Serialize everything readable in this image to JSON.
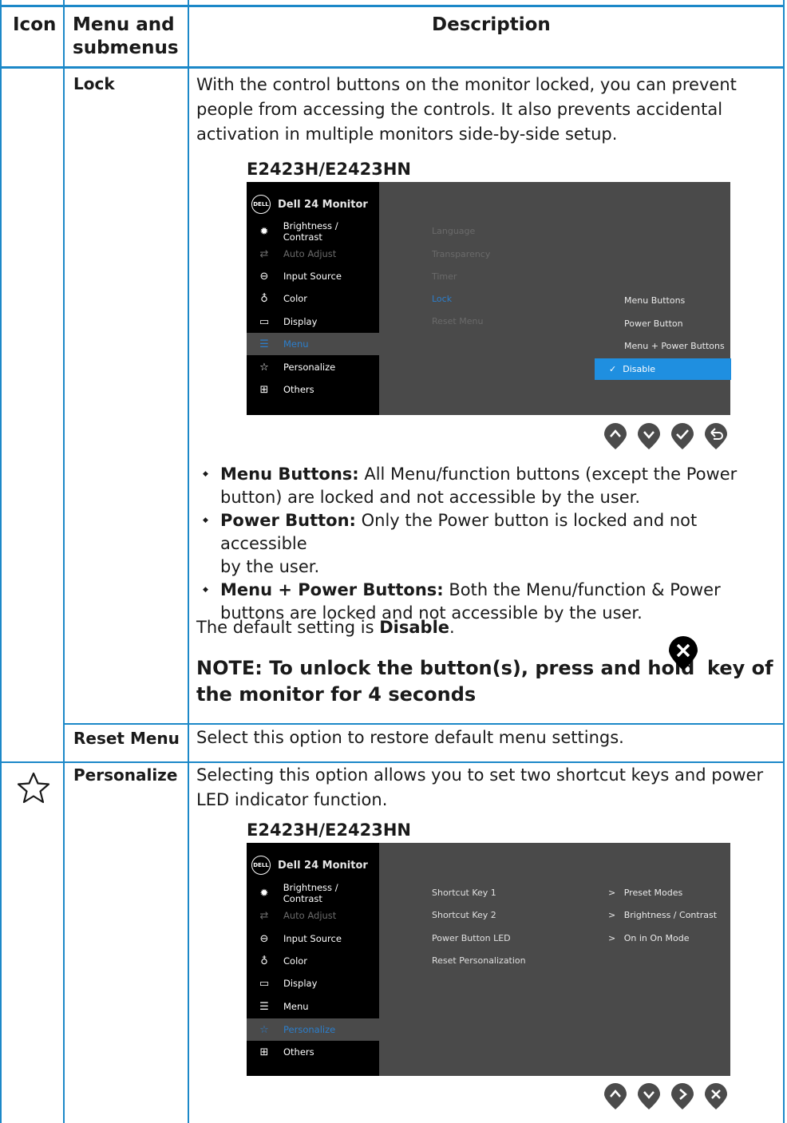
{
  "header": {
    "icon": "Icon",
    "menu_line1": "Menu and",
    "menu_line2": "submenus",
    "description": "Description"
  },
  "lock": {
    "title": "Lock",
    "intro_lines": [
      "With the control buttons on the monitor locked, you can prevent",
      "people from accessing the controls. It also prevents accidental",
      "activation in multiple monitors side-by-side setup."
    ],
    "model": "E2423H/E2423HN",
    "bullets": [
      {
        "label": "Menu Buttons:",
        "line1": " All Menu/function buttons (except the Power",
        "line2": "button) are locked and not accessible by the user."
      },
      {
        "label": "Power Button:",
        "line1": " Only the Power button is locked and not accessible",
        "line2": "by the user."
      },
      {
        "label": "Menu + Power Buttons:",
        "line1": " Both the Menu/function & Power",
        "line2": "buttons are locked and not accessible by the user."
      }
    ],
    "default_prefix": "The default setting is ",
    "default_value": "Disable",
    "default_suffix": ".",
    "note_part1": "NOTE: To unlock the button(s), press and hold",
    "note_part2": "key of",
    "note_line2": "the monitor for 4 seconds"
  },
  "reset_menu": {
    "title": "Reset Menu",
    "text": "Select this option to restore default menu settings."
  },
  "personalize": {
    "title": "Personalize",
    "text_line1": "Selecting this option allows you to set two shortcut keys and power",
    "text_line2": "LED indicator function.",
    "model": "E2423H/E2423HN"
  },
  "osd": {
    "logo": "DELL",
    "title": "Dell 24 Monitor",
    "menu": [
      "Brightness / Contrast",
      "Auto Adjust",
      "Input Source",
      "Color",
      "Display",
      "Menu",
      "Personalize",
      "Others"
    ],
    "lock_sub": [
      "Language",
      "Transparency",
      "Timer",
      "Lock",
      "Reset Menu"
    ],
    "lock_options": [
      "Menu Buttons",
      "Power Button",
      "Menu + Power Buttons",
      "Disable"
    ],
    "personalize_sub": [
      "Shortcut Key 1",
      "Shortcut Key 2",
      "Power Button LED",
      "Reset Personalization"
    ],
    "personalize_values": [
      "Preset Modes",
      "Brightness / Contrast",
      "On in On Mode"
    ]
  },
  "colors": {
    "rule": "#1c88c8",
    "osd_panel": "#4a4a4a",
    "osd_highlight": "#1f8fe0",
    "osd_selected_text": "#2c7ecb"
  }
}
